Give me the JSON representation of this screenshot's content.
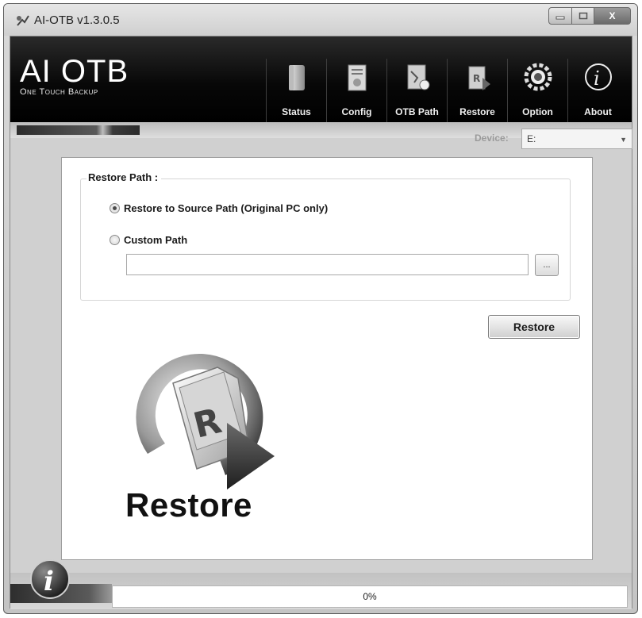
{
  "window": {
    "title": "AI-OTB v1.3.0.5",
    "minimize_label": "▭",
    "maximize_label": "□",
    "close_label": "X"
  },
  "header": {
    "logo_main": "AI OTB",
    "logo_sub": "One Touch Backup"
  },
  "toolbar": {
    "items": [
      {
        "label": "Status",
        "icon": "status-icon"
      },
      {
        "label": "Config",
        "icon": "config-icon"
      },
      {
        "label": "OTB Path",
        "icon": "otb-path-icon"
      },
      {
        "label": "Restore",
        "icon": "restore-icon"
      },
      {
        "label": "Option",
        "icon": "option-icon"
      },
      {
        "label": "About",
        "icon": "about-icon"
      }
    ]
  },
  "device": {
    "label": "Device:",
    "selected": "E:"
  },
  "restore_path": {
    "group_title": "Restore Path :",
    "option_source": "Restore to Source Path (Original PC only)",
    "option_custom": "Custom Path",
    "selected_option": "source",
    "custom_path_value": "",
    "browse_label": "..."
  },
  "actions": {
    "restore_button": "Restore"
  },
  "hero": {
    "title": "Restore",
    "icon_letter": "R"
  },
  "progress": {
    "value": 0,
    "text": "0%"
  }
}
